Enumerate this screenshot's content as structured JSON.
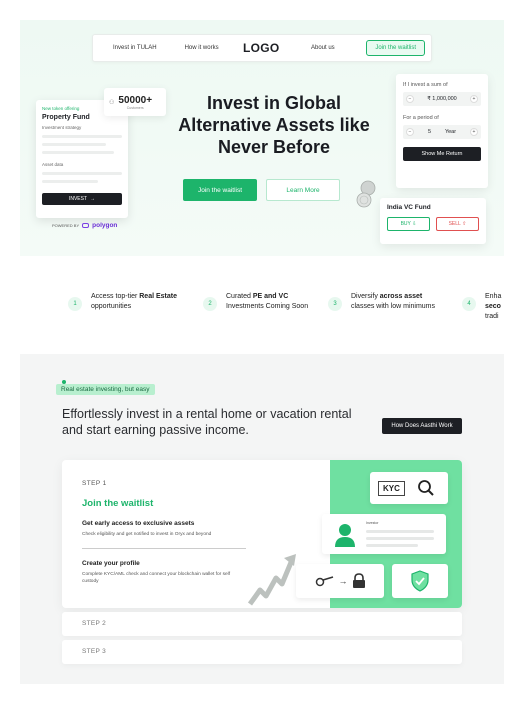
{
  "nav": {
    "link1": "Invest in TULAH",
    "link2": "How it works",
    "logo": "LOGO",
    "link3": "About us",
    "join": "Join the waitlist"
  },
  "hero": {
    "title_line1": "Invest in Global",
    "title_line2": "Alternative Assets like",
    "title_line3": "Never Before",
    "btn_waitlist": "Join the waitlist",
    "btn_learn": "Learn More"
  },
  "stat": {
    "value": "50000+",
    "label": "Customers",
    "icon": "user-count-icon"
  },
  "property_card": {
    "tag": "New token offering",
    "title": "Property Fund",
    "label1": "Investment strategy",
    "label2": "Asset data",
    "invest": "INVEST"
  },
  "powered": {
    "label": "POWERED BY",
    "brand": "polygon"
  },
  "calculator": {
    "q1": "If I invest a sum of",
    "amount": "₹ 1,000,000",
    "q2": "For a period of",
    "years": "5",
    "unit": "Year",
    "show": "Show Me Return"
  },
  "fund": {
    "title": "India VC Fund",
    "buy": "BUY",
    "sell": "SELL"
  },
  "features": [
    {
      "num": "1",
      "pre": "Access top-tier ",
      "bold": "Real Estate",
      "post": "opportunities"
    },
    {
      "num": "2",
      "pre": "Curated ",
      "bold": "PE and VC",
      "post": "Investments Coming Soon"
    },
    {
      "num": "3",
      "pre": "Diversify ",
      "bold": "across asset",
      "post": "classes with low minimums"
    },
    {
      "num": "4",
      "pre": "Enha",
      "bold": "seco",
      "post": "tradi"
    }
  ],
  "how": {
    "pill": "Real estate investing, but easy",
    "heading": "Effortlessly invest in a rental home or vacation rental and start earning passive income.",
    "button": "How Does Aasthi Work",
    "step1_label": "STEP 1",
    "step1_title": "Join the waitlist",
    "item1_title": "Get early access to exclusive assets",
    "item1_desc": "Check eligibility and get notified to invest in Oryx and beyond",
    "item2_title": "Create your profile",
    "item2_desc": "Complete KYC/AML check and connect your blockchain wallet for self custody",
    "kyc": "KYC",
    "investor_label": "Investor",
    "step2_label": "STEP 2",
    "step3_label": "STEP 3"
  },
  "colors": {
    "accent": "#1db46b",
    "dark": "#1d1f24",
    "green_panel": "#6fe0a1",
    "sell": "#e05050"
  }
}
